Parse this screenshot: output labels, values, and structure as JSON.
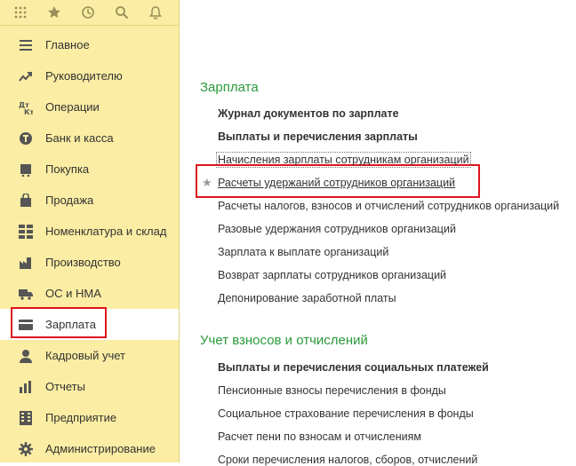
{
  "sidebar": {
    "topbar_icons": [
      "apps-grid-icon",
      "star-icon",
      "history-icon",
      "search-icon",
      "bell-icon"
    ],
    "items": [
      {
        "label": "Главное",
        "icon": "menu-lines-icon"
      },
      {
        "label": "Руководителю",
        "icon": "trend-icon"
      },
      {
        "label": "Операции",
        "icon": "dt-kt-icon"
      },
      {
        "label": "Банк и касса",
        "icon": "coin-icon"
      },
      {
        "label": "Покупка",
        "icon": "cart-icon"
      },
      {
        "label": "Продажа",
        "icon": "bag-icon"
      },
      {
        "label": "Номенклатура и склад",
        "icon": "grid-icon"
      },
      {
        "label": "Производство",
        "icon": "factory-icon"
      },
      {
        "label": "ОС и НМА",
        "icon": "truck-icon"
      },
      {
        "label": "Зарплата",
        "icon": "wallet-icon"
      },
      {
        "label": "Кадровый учет",
        "icon": "person-icon"
      },
      {
        "label": "Отчеты",
        "icon": "chart-icon"
      },
      {
        "label": "Предприятие",
        "icon": "building-icon"
      },
      {
        "label": "Администрирование",
        "icon": "gear-icon"
      }
    ],
    "active_item": "Зарплата"
  },
  "main": {
    "section1_title": "Зарплата",
    "section1_links": [
      "Журнал документов по зарплате",
      "Выплаты и перечисления зарплаты",
      "Начисления зарплаты сотрудникам организаций",
      "Расчеты удержаний сотрудников организаций",
      "Расчеты налогов, взносов и отчислений сотрудников организаций",
      "Разовые удержания сотрудников организаций",
      "Зарплата к выплате организаций",
      "Возврат зарплаты сотрудников организаций",
      "Депонирование заработной платы"
    ],
    "section2_title": "Учет взносов и отчислений",
    "section2_links": [
      "Выплаты и перечисления социальных платежей",
      "Пенсионные взносы перечисления в фонды",
      "Социальное страхование перечисления в фонды",
      "Расчет пени по взносам и отчислениям",
      "Сроки перечисления налогов, сборов, отчислений"
    ]
  },
  "colors": {
    "sidebar_bg": "#fbeda3",
    "section_title": "#2a9a3a",
    "highlight": "#e0141f"
  }
}
